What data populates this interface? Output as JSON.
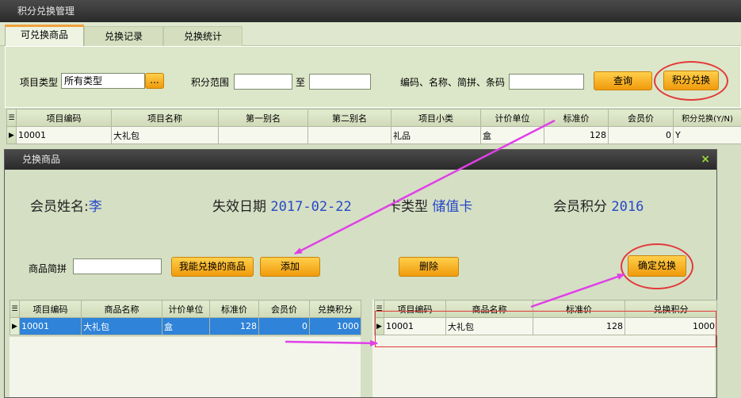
{
  "window": {
    "title": "积分兑换管理"
  },
  "tabs": [
    {
      "label": "可兑换商品"
    },
    {
      "label": "兑换记录"
    },
    {
      "label": "兑换统计"
    }
  ],
  "filter": {
    "type_label": "项目类型",
    "type_value": "所有类型",
    "ellipsis_label": "...",
    "range_label": "积分范围",
    "range_to": "至",
    "search_label": "编码、名称、简拼、条码",
    "query_button": "查询",
    "exchange_button": "积分兑换"
  },
  "main_table": {
    "columns": [
      "项目编码",
      "项目名称",
      "第一别名",
      "第二别名",
      "项目小类",
      "计价单位",
      "标准价",
      "会员价",
      "积分兑换(Y/N)"
    ],
    "rows": [
      [
        "10001",
        "大礼包",
        "",
        "",
        "礼品",
        "盒",
        "128",
        "0",
        "Y"
      ]
    ]
  },
  "dialog": {
    "title": "兑换商品",
    "close_label": "×",
    "member_name_label": "会员姓名:",
    "member_name": "李",
    "expire_label": "失效日期",
    "expire_date": "2017-02-22",
    "card_type_label": "卡类型",
    "card_type": "储值卡",
    "points_label": "会员积分",
    "points": "2016",
    "pinyin_label": "商品简拼",
    "my_items_button": "我能兑换的商品",
    "add_button": "添加",
    "delete_button": "删除",
    "confirm_button": "确定兑换",
    "left_table": {
      "columns": [
        "项目编码",
        "商品名称",
        "计价单位",
        "标准价",
        "会员价",
        "兑换积分"
      ],
      "rows": [
        [
          "10001",
          "大礼包",
          "盒",
          "128",
          "0",
          "1000"
        ]
      ]
    },
    "right_table": {
      "columns": [
        "项目编码",
        "商品名称",
        "标准价",
        "兑换积分"
      ],
      "rows": [
        [
          "10001",
          "大礼包",
          "128",
          "1000"
        ]
      ]
    }
  },
  "colors": {
    "accent": "#f09a0c",
    "annotation_arrow": "#e040e8",
    "annotation_circle": "#e23a3a"
  }
}
